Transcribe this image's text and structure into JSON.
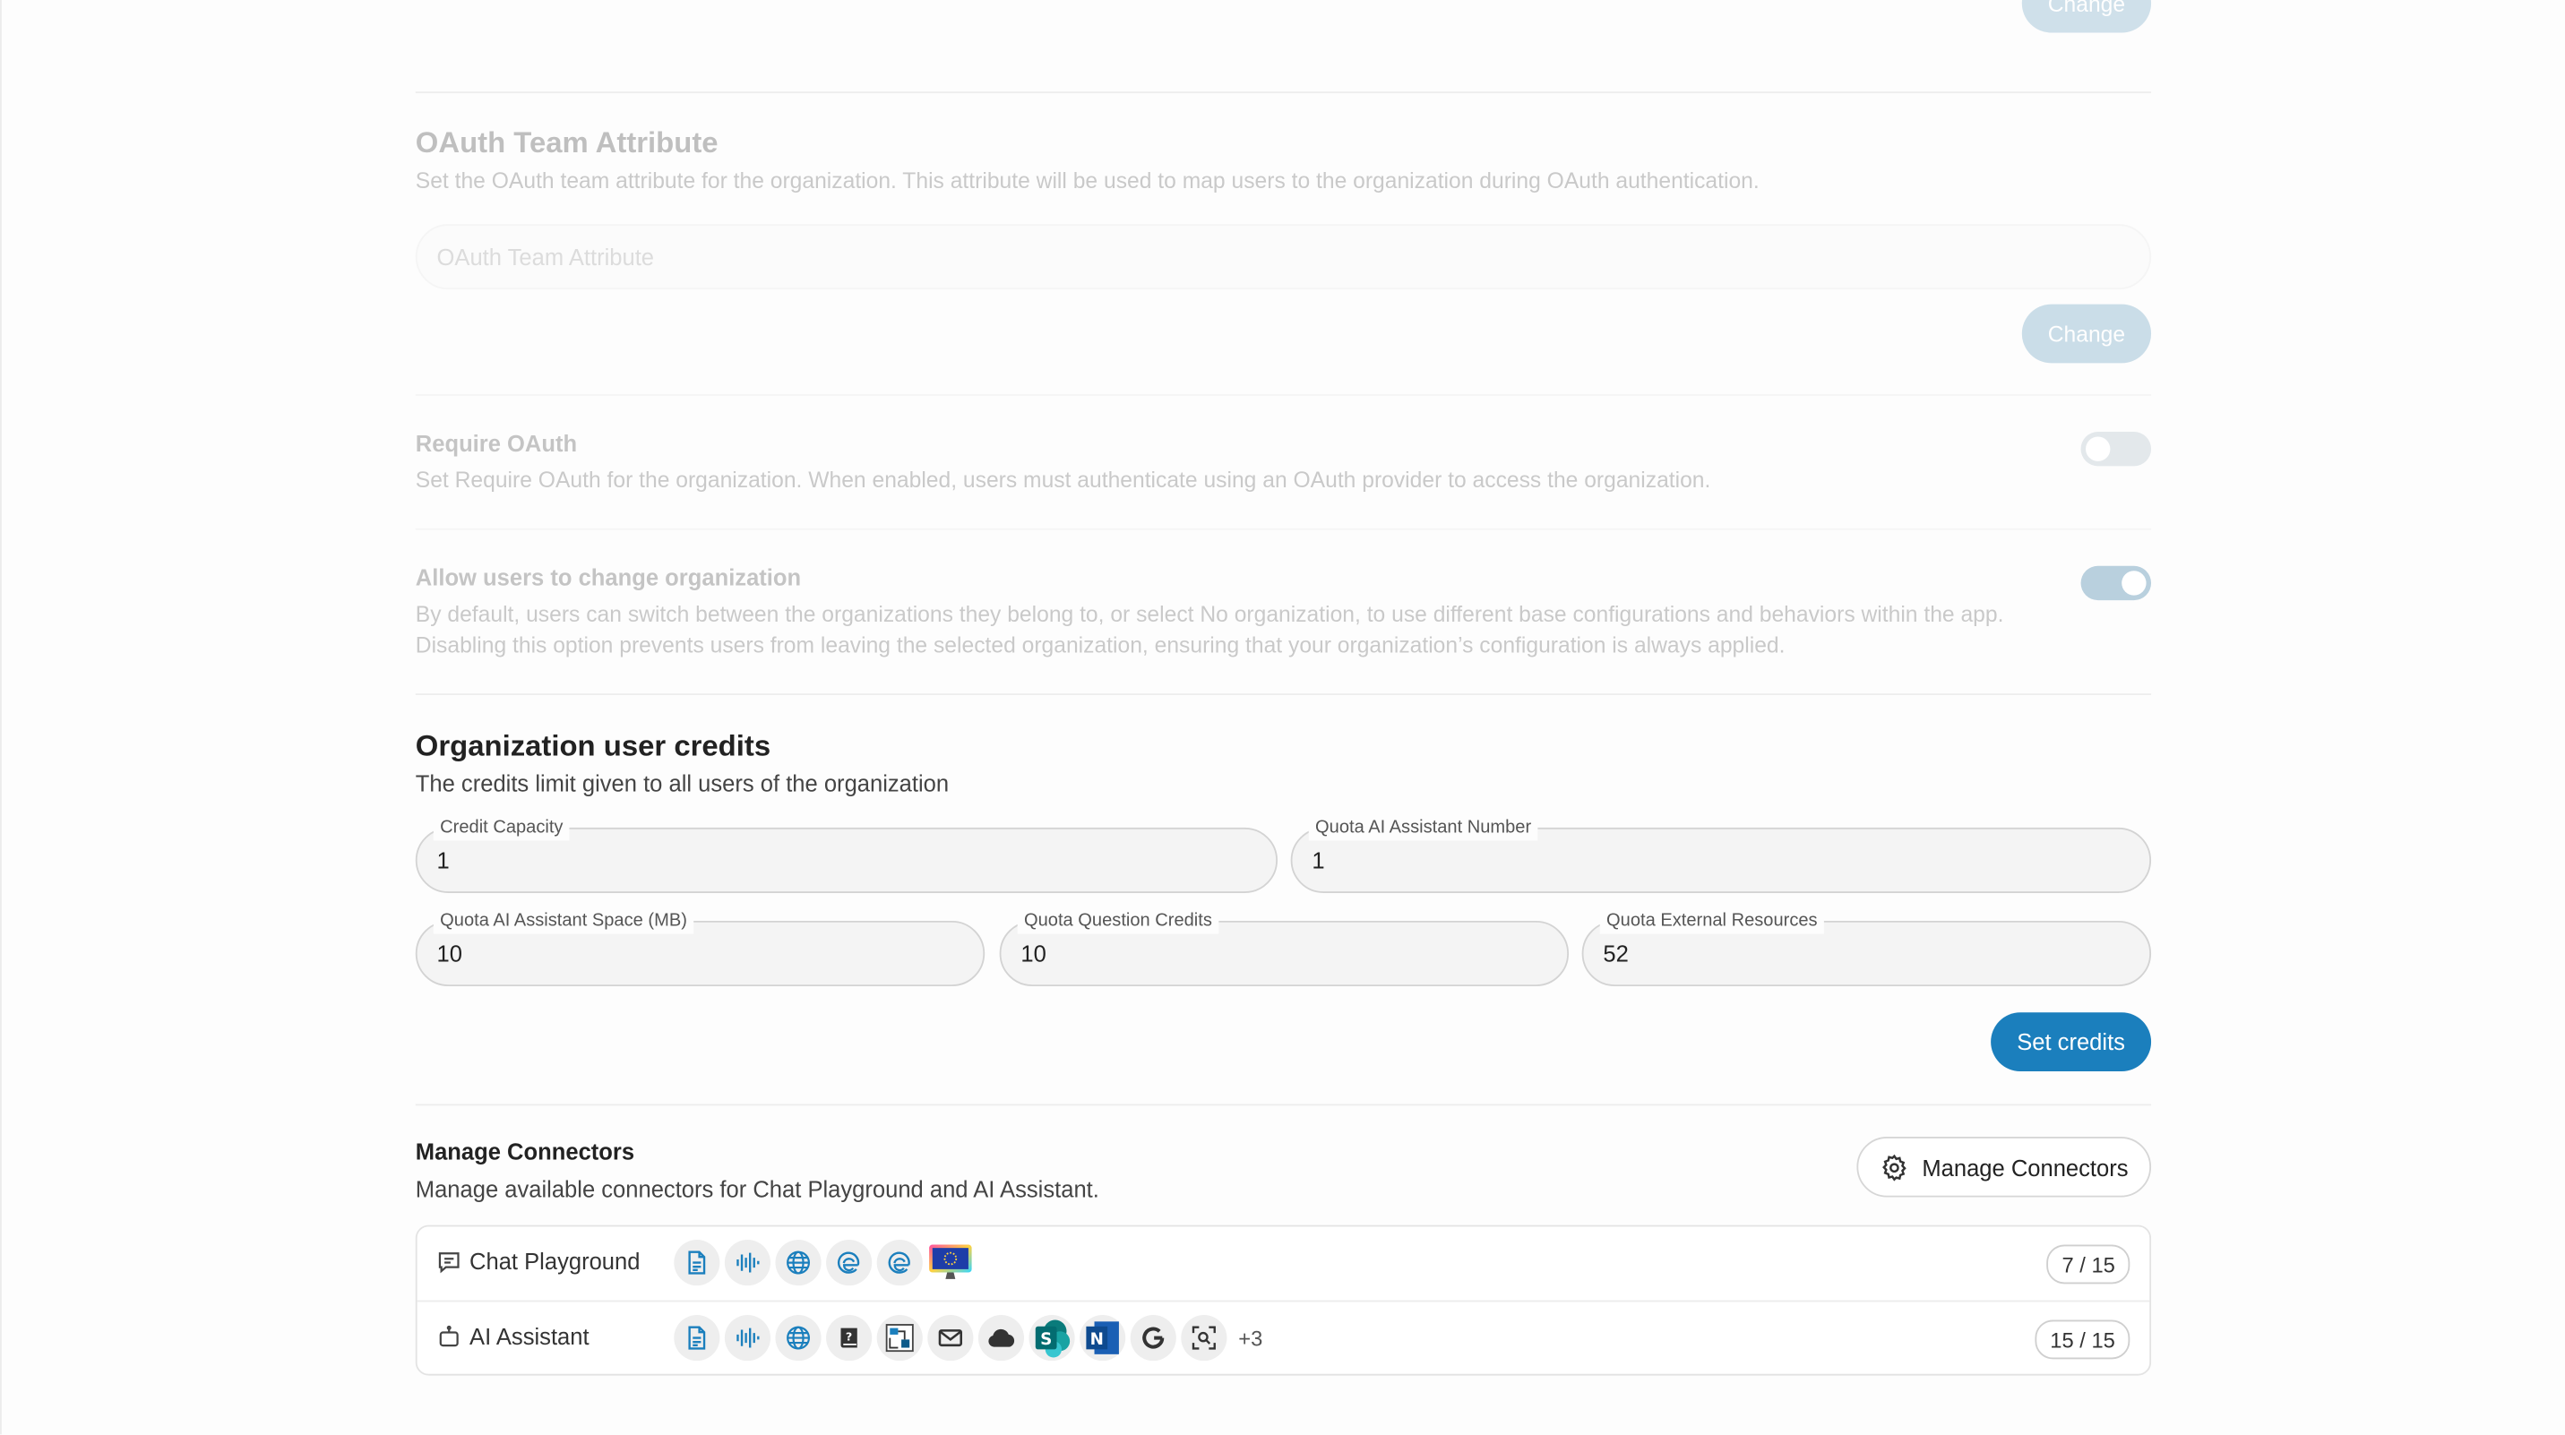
{
  "top": {
    "change_label": "Change"
  },
  "oauth_team": {
    "title": "OAuth Team Attribute",
    "description": "Set the OAuth team attribute for the organization. This attribute will be used to map users to the organization during OAuth authentication.",
    "placeholder": "OAuth Team Attribute",
    "change_label": "Change"
  },
  "require_oauth": {
    "title": "Require OAuth",
    "description": "Set Require OAuth for the organization. When enabled, users must authenticate using an OAuth provider to access the organization.",
    "enabled": false
  },
  "allow_change_org": {
    "title": "Allow users to change organization",
    "description": "By default, users can switch between the organizations they belong to, or select No organization, to use different base configurations and behaviors within the app. Disabling this option prevents users from leaving the selected organization, ensuring that your organization’s configuration is always applied.",
    "enabled": true
  },
  "credits": {
    "title": "Organization user credits",
    "subtitle": "The credits limit given to all users of the organization",
    "fields": {
      "credit_capacity": {
        "label": "Credit Capacity",
        "value": "1"
      },
      "quota_ai_assistant_number": {
        "label": "Quota AI Assistant Number",
        "value": "1"
      },
      "quota_ai_assistant_space": {
        "label": "Quota AI Assistant Space (MB)",
        "value": "10"
      },
      "quota_question_credits": {
        "label": "Quota Question Credits",
        "value": "10"
      },
      "quota_external_resources": {
        "label": "Quota External Resources",
        "value": "52"
      }
    },
    "set_label": "Set credits"
  },
  "connectors": {
    "title": "Manage Connectors",
    "subtitle": "Manage available connectors for Chat Playground and AI Assistant.",
    "button_label": "Manage Connectors",
    "rows": [
      {
        "label": "Chat Playground",
        "icons": [
          "document-icon",
          "audio-wave-icon",
          "globe-icon",
          "edge-icon",
          "edge-icon",
          "monitor-icon"
        ],
        "count": "7 / 15"
      },
      {
        "label": "AI Assistant",
        "icons": [
          "document-icon",
          "audio-wave-icon",
          "globe-icon",
          "help-book-icon",
          "diagram-icon",
          "mail-icon",
          "cloud-icon",
          "sharepoint-icon",
          "onenote-icon",
          "google-icon",
          "scan-icon"
        ],
        "more": "+3",
        "count": "15 / 15"
      }
    ]
  },
  "colors": {
    "accent": "#1b7fbd",
    "disabled_accent": "#a9c8db",
    "toggle_off": "#d5dde2",
    "toggle_on": "#7fb7d8"
  }
}
